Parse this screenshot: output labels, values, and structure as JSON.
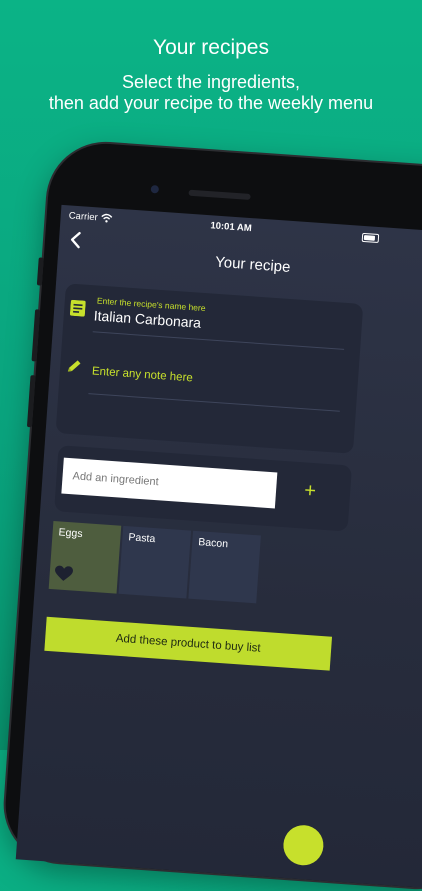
{
  "promo": {
    "title": "Your recipes",
    "subtitle_line1": "Select the ingredients,",
    "subtitle_line2": "then add your recipe to the weekly menu"
  },
  "status_bar": {
    "carrier": "Carrier",
    "time": "10:01 AM"
  },
  "nav": {
    "title": "Your recipe",
    "back_icon": "chevron-left-icon"
  },
  "recipe_form": {
    "name_hint": "Enter the recipe's name here",
    "name_value": "Italian Carbonara",
    "note_placeholder": "Enter any note here"
  },
  "ingredient_entry": {
    "placeholder": "Add an ingredient",
    "add_label": "+"
  },
  "ingredients": [
    {
      "label": "Eggs",
      "selected": true
    },
    {
      "label": "Pasta",
      "selected": false
    },
    {
      "label": "Bacon",
      "selected": false
    }
  ],
  "buy_button_label": "Add these product to buy list",
  "colors": {
    "background": "#0aa47e",
    "accent": "#c7e02c",
    "screen": "#2a3042",
    "card": "#232838",
    "selected_tile": "#4e5d3e"
  }
}
